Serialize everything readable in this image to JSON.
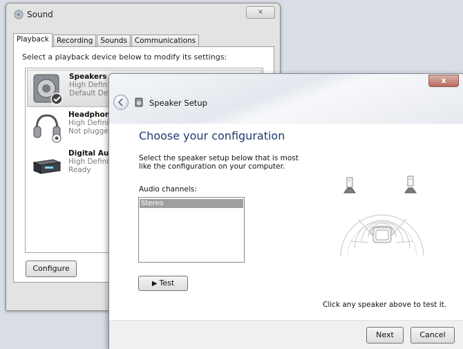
{
  "sound_dialog": {
    "title": "Sound",
    "close_label": "⨯",
    "tabs": [
      {
        "label": "Playback"
      },
      {
        "label": "Recording"
      },
      {
        "label": "Sounds"
      },
      {
        "label": "Communications"
      }
    ],
    "instruction": "Select a playback device below to modify its settings:",
    "devices": [
      {
        "name": "Speakers",
        "line1": "High Defin",
        "line2": "Default Dev",
        "icon": "speaker-icon"
      },
      {
        "name": "Headphone",
        "line1": "High Defini",
        "line2": "Not plugge",
        "icon": "headphones-icon"
      },
      {
        "name": "Digital Aud",
        "line1": "High Defini",
        "line2": "Ready",
        "icon": "digital-audio-icon"
      }
    ],
    "configure_label": "Configure"
  },
  "speaker_setup": {
    "title": "Speaker Setup",
    "close_label": "x",
    "heading": "Choose your configuration",
    "description": "Select the speaker setup below that is most like the configuration on your computer.",
    "channels_label": "Audio channels:",
    "channels": [
      "Stereo"
    ],
    "selected_channel": "Stereo",
    "test_label": "Test",
    "test_hint": "Click any speaker above to test it.",
    "next_label": "Next",
    "cancel_label": "Cancel"
  }
}
